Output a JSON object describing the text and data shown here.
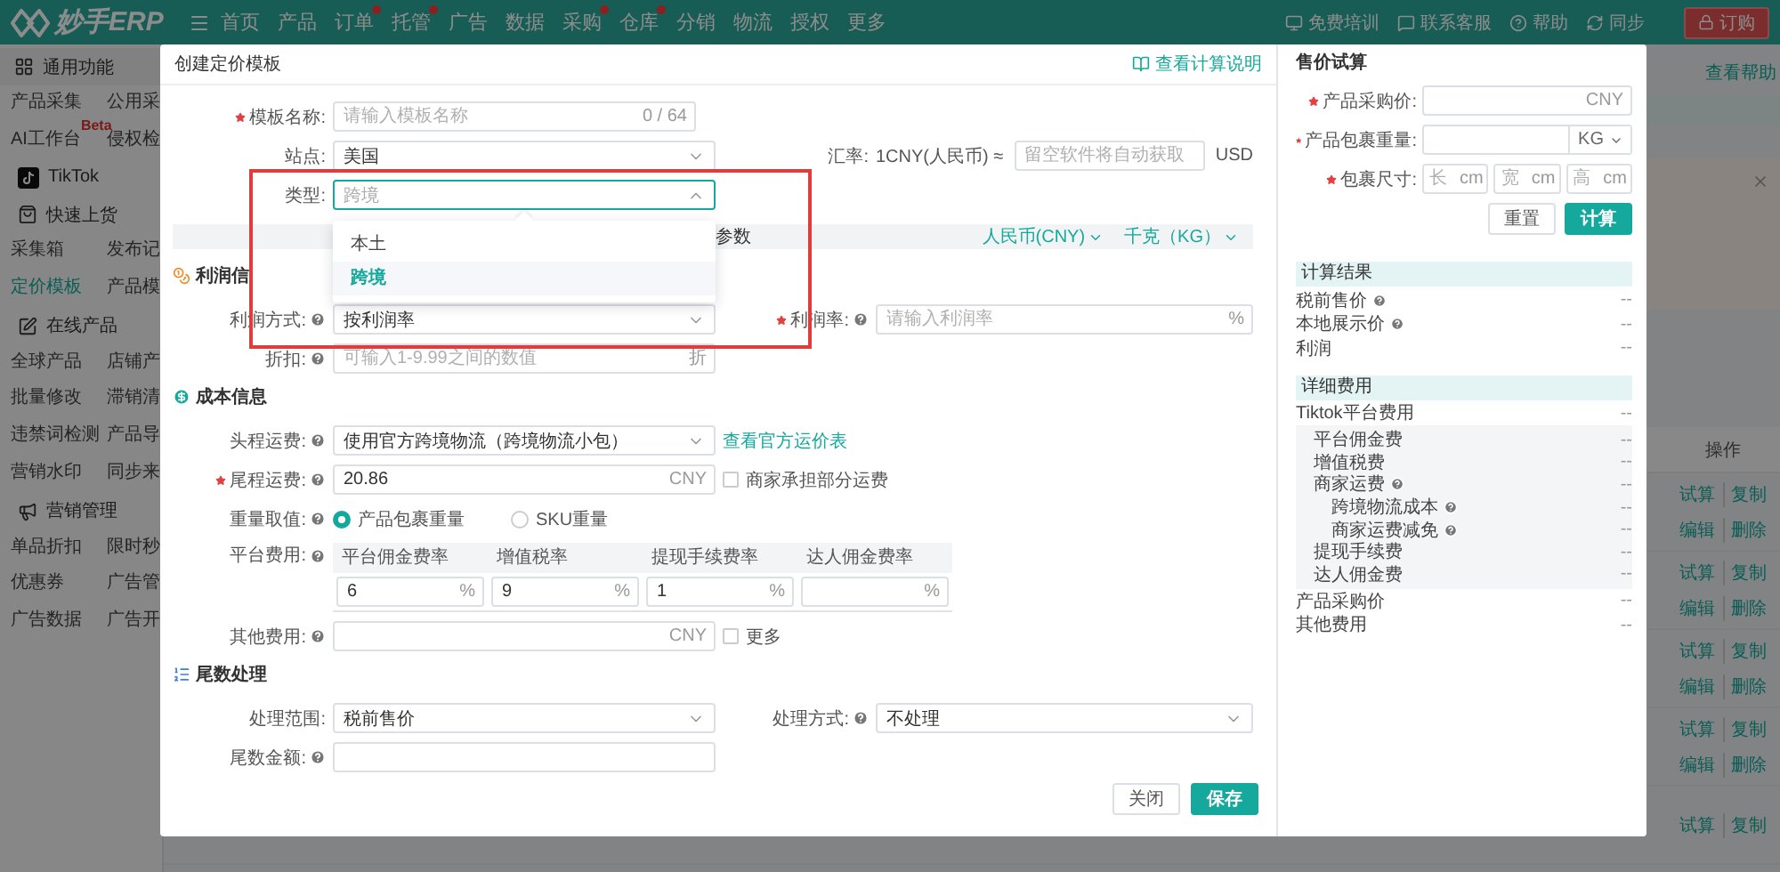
{
  "header": {
    "logo": "妙手ERP",
    "nav": [
      {
        "label": "首页",
        "dot": false
      },
      {
        "label": "产品",
        "dot": false
      },
      {
        "label": "订单",
        "dot": true
      },
      {
        "label": "托管",
        "dot": true
      },
      {
        "label": "广告",
        "dot": false
      },
      {
        "label": "数据",
        "dot": false
      },
      {
        "label": "采购",
        "dot": true
      },
      {
        "label": "仓库",
        "dot": true
      },
      {
        "label": "分销",
        "dot": false
      },
      {
        "label": "物流",
        "dot": false
      },
      {
        "label": "授权",
        "dot": false
      },
      {
        "label": "更多",
        "dot": false
      }
    ],
    "tools": [
      {
        "kind": "training",
        "label": "免费培训"
      },
      {
        "kind": "service",
        "label": "联系客服"
      },
      {
        "kind": "help",
        "label": "帮助"
      },
      {
        "kind": "sync",
        "label": "同步"
      }
    ],
    "order_button": "订购"
  },
  "sidebar": [
    {
      "kind": "category",
      "title": "通用功能",
      "items": [
        {
          "label": "产品采集",
          "selected": false
        },
        {
          "label": "公用采",
          "selected": false
        },
        {
          "label": "AI工作台",
          "badge": "Beta",
          "selected": false
        },
        {
          "label": "侵权检",
          "selected": false
        }
      ]
    },
    {
      "kind": "platform",
      "title": "TikTok"
    },
    {
      "kind": "group",
      "title": "快速上货",
      "items": [
        {
          "label": "采集箱",
          "selected": false
        },
        {
          "label": "发布记",
          "selected": false
        },
        {
          "label": "定价模板",
          "selected": true
        },
        {
          "label": "产品模",
          "selected": false
        }
      ]
    },
    {
      "kind": "group",
      "title": "在线产品",
      "items": [
        {
          "label": "全球产品",
          "selected": false
        },
        {
          "label": "店铺产",
          "selected": false
        },
        {
          "label": "批量修改",
          "selected": false
        },
        {
          "label": "滞销清",
          "selected": false
        },
        {
          "label": "违禁词检测",
          "selected": false
        },
        {
          "label": "产品导",
          "selected": false
        },
        {
          "label": "营销水印",
          "selected": false
        },
        {
          "label": "同步来",
          "selected": false
        }
      ]
    },
    {
      "kind": "group",
      "title": "营销管理",
      "items": [
        {
          "label": "单品折扣",
          "selected": false
        },
        {
          "label": "限时秒",
          "selected": false
        },
        {
          "label": "优惠券",
          "selected": false
        },
        {
          "label": "广告管",
          "selected": false
        },
        {
          "label": "广告数据",
          "selected": false
        },
        {
          "label": "广告开",
          "selected": false
        }
      ]
    }
  ],
  "background": {
    "help_link": "查看帮助",
    "column": "操作",
    "rows": [
      {
        "actions": [
          "试算",
          "复制",
          "编辑",
          "删除"
        ]
      },
      {
        "actions": [
          "试算",
          "复制",
          "编辑",
          "删除"
        ]
      },
      {
        "actions": [
          "试算",
          "复制",
          "编辑",
          "删除"
        ]
      },
      {
        "actions": [
          "试算",
          "复制",
          "编辑",
          "删除"
        ]
      },
      {
        "actions": [
          "试算",
          "复制"
        ]
      }
    ]
  },
  "modal": {
    "title": "创建定价模板",
    "help_link": "查看计算说明",
    "sections": [
      {
        "kind": "basic",
        "rows": [
          [
            {
              "kind": "input",
              "wide": true,
              "label": "模板名称:",
              "required": true,
              "placeholder": "请输入模板名称",
              "suffix": "0 / 64"
            }
          ],
          [
            {
              "kind": "select",
              "label": "站点:",
              "value": "美国"
            },
            {
              "kind": "rate",
              "label": "汇率:",
              "prefix": "1CNY(人民币) ≈",
              "placeholder": "留空软件将自动获取",
              "suffix": "USD"
            }
          ],
          [
            {
              "kind": "select",
              "label": "类型:",
              "value": "跨境",
              "expanded": true,
              "options": [
                {
                  "label": "本土",
                  "selected": false
                },
                {
                  "label": "跨境",
                  "selected": true
                }
              ]
            }
          ]
        ]
      },
      {
        "kind": "bar",
        "title": "参数",
        "units": [
          "人民币(CNY)",
          "千克（KG）"
        ]
      },
      {
        "kind": "profit",
        "title": "利润信",
        "rows": [
          [
            {
              "kind": "select",
              "label": "利润方式:",
              "help": true,
              "value": "按利润率"
            },
            {
              "kind": "input",
              "label": "利润率:",
              "required": true,
              "help": true,
              "placeholder": "请输入利润率",
              "suffix": "%"
            }
          ],
          [
            {
              "kind": "input",
              "label": "折扣:",
              "help": true,
              "placeholder": "可输入1-9.99之间的数值",
              "suffix": "折"
            }
          ]
        ]
      },
      {
        "kind": "cost",
        "title": "成本信息",
        "rows": [
          [
            {
              "kind": "select",
              "label": "头程运费:",
              "help": true,
              "value": "使用官方跨境物流（跨境物流小包）",
              "link": "查看官方运价表"
            }
          ],
          [
            {
              "kind": "input",
              "label": "尾程运费:",
              "required": true,
              "help": true,
              "value": "20.86",
              "suffix": "CNY",
              "checkbox": {
                "label": "商家承担部分运费",
                "checked": false
              }
            }
          ],
          [
            {
              "kind": "radio",
              "label": "重量取值:",
              "help": true,
              "options": [
                {
                  "label": "产品包裹重量",
                  "selected": true
                },
                {
                  "label": "SKU重量",
                  "selected": false
                }
              ]
            }
          ],
          [
            {
              "kind": "fee_table",
              "label": "平台费用:",
              "help": true,
              "columns": [
                {
                  "title": "平台佣金费率",
                  "value": "6",
                  "suffix": "%"
                },
                {
                  "title": "增值税率",
                  "value": "9",
                  "suffix": "%"
                },
                {
                  "title": "提现手续费率",
                  "value": "1",
                  "suffix": "%"
                },
                {
                  "title": "达人佣金费率",
                  "suffix": "%"
                }
              ]
            }
          ],
          [
            {
              "kind": "input",
              "label": "其他费用:",
              "help": true,
              "suffix": "CNY",
              "checkbox": {
                "label": "更多",
                "checked": false
              }
            }
          ]
        ]
      },
      {
        "kind": "tail",
        "title": "尾数处理",
        "rows": [
          [
            {
              "kind": "select",
              "label": "处理范围:",
              "value": "税前售价"
            },
            {
              "kind": "select",
              "label": "处理方式:",
              "help": true,
              "value": "不处理"
            }
          ],
          [
            {
              "kind": "input",
              "label": "尾数金额:",
              "help": true
            }
          ]
        ]
      }
    ],
    "buttons": [
      {
        "kind": "secondary",
        "label": "关闭"
      },
      {
        "kind": "primary",
        "label": "保存"
      }
    ]
  },
  "calculator": {
    "title": "售价试算",
    "fields": [
      {
        "kind": "input",
        "label": "产品采购价:",
        "required": true,
        "suffix": "CNY"
      },
      {
        "kind": "unit",
        "label": "产品包裹重量:",
        "required": true,
        "unit": "KG"
      },
      {
        "kind": "dims",
        "label": "包裹尺寸:",
        "required": true,
        "parts": [
          {
            "placeholder": "长",
            "suffix": "cm"
          },
          {
            "placeholder": "宽",
            "suffix": "cm"
          },
          {
            "placeholder": "高",
            "suffix": "cm"
          }
        ]
      }
    ],
    "buttons": [
      {
        "kind": "secondary",
        "label": "重置"
      },
      {
        "kind": "primary",
        "label": "计算"
      }
    ],
    "groups": [
      {
        "title": "计算结果",
        "rows": [
          {
            "label": "税前售价",
            "help": true,
            "value": "--"
          },
          {
            "label": "本地展示价",
            "help": true,
            "value": "--"
          },
          {
            "label": "利润",
            "value": "--"
          }
        ]
      },
      {
        "title": "详细费用",
        "rows": [
          {
            "label": "Tiktok平台费用",
            "value": "--",
            "children": [
              {
                "label": "平台佣金费",
                "value": "--"
              },
              {
                "label": "增值税费",
                "value": "--"
              },
              {
                "label": "商家运费",
                "help": true,
                "value": "--",
                "children": [
                  {
                    "label": "跨境物流成本",
                    "help": true,
                    "value": "--"
                  },
                  {
                    "label": "商家运费减免",
                    "help": true,
                    "value": "--"
                  }
                ]
              },
              {
                "label": "提现手续费",
                "value": "--"
              },
              {
                "label": "达人佣金费",
                "value": "--"
              }
            ]
          },
          {
            "label": "产品采购价",
            "value": "--"
          },
          {
            "label": "其他费用",
            "value": "--"
          }
        ]
      }
    ]
  }
}
